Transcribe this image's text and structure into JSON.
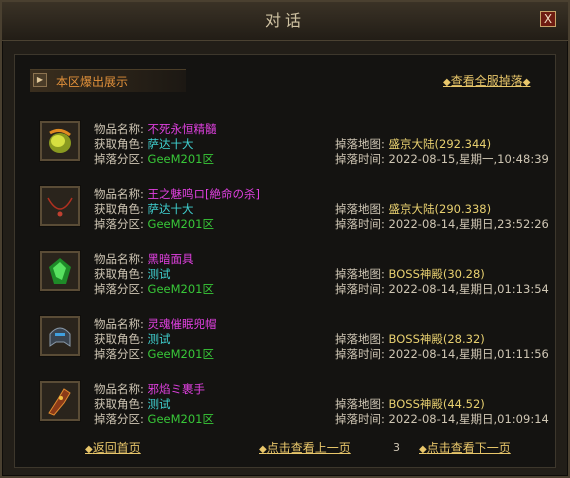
{
  "window": {
    "title": "对话",
    "close_label": "X"
  },
  "header": {
    "tab_label": "本区爆出展示",
    "view_all": "查看全服掉落"
  },
  "labels": {
    "item_name": "物品名称:",
    "character": "获取角色:",
    "zone": "掉落分区:",
    "map": "掉落地图:",
    "time": "掉落时间:"
  },
  "drops": [
    {
      "item": "不死永恒精髓",
      "character": "萨达十大",
      "zone": "GeeM201区",
      "map": "盛京大陆(292.344)",
      "time": "2022-08-15,星期一,10:48:39",
      "icon": "orb-icon"
    },
    {
      "item": "王之魅鸣ロ[絶命の杀]",
      "character": "萨达十大",
      "zone": "GeeM201区",
      "map": "盛京大陆(290.338)",
      "time": "2022-08-14,星期日,23:52:26",
      "icon": "necklace-icon"
    },
    {
      "item": "黑暗面具",
      "character": "测试",
      "zone": "GeeM201区",
      "map": "BOSS神殿(30.28)",
      "time": "2022-08-14,星期日,01:13:54",
      "icon": "gem-icon"
    },
    {
      "item": "灵魂催眠兜帽",
      "character": "测试",
      "zone": "GeeM201区",
      "map": "BOSS神殿(28.32)",
      "time": "2022-08-14,星期日,01:11:56",
      "icon": "helmet-icon"
    },
    {
      "item": "邪焰ミ裹手",
      "character": "测试",
      "zone": "GeeM201区",
      "map": "BOSS神殿(44.52)",
      "time": "2022-08-14,星期日,01:09:14",
      "icon": "glove-icon"
    }
  ],
  "footer": {
    "home": "返回首页",
    "prev": "点击查看上一页",
    "page": "3",
    "next": "点击查看下一页"
  }
}
